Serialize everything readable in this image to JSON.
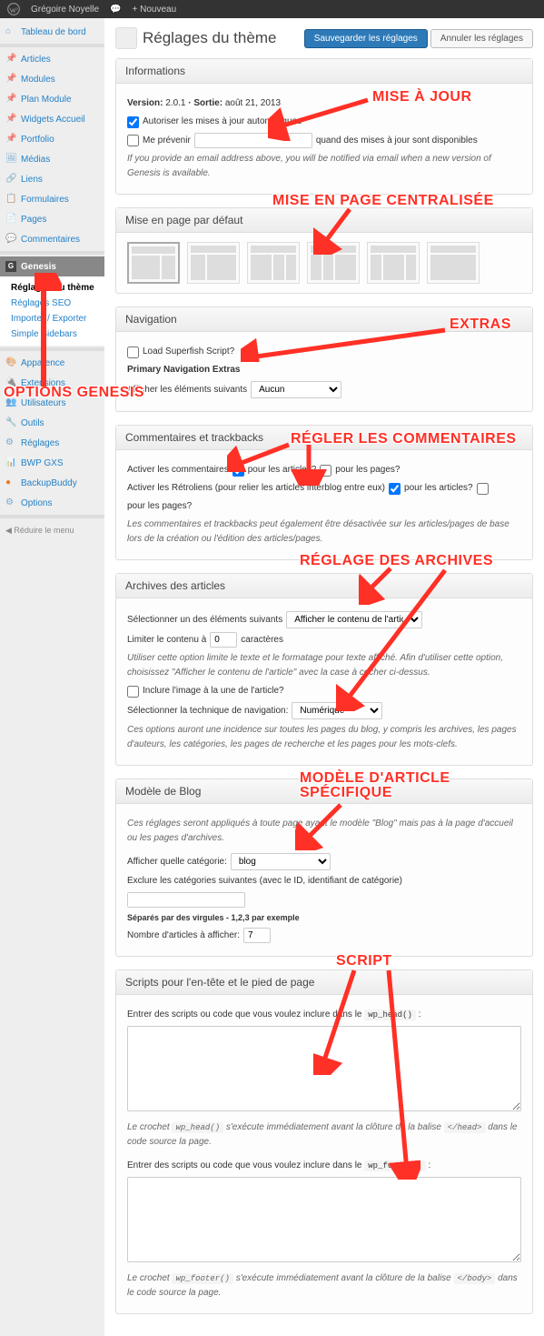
{
  "adminBar": {
    "site": "Grégoire Noyelle",
    "comment": "",
    "new": "+ Nouveau"
  },
  "sidebar": {
    "items": [
      "Tableau de bord",
      "Articles",
      "Modules",
      "Plan Module",
      "Widgets Accueil",
      "Portfolio",
      "Médias",
      "Liens",
      "Formulaires",
      "Pages",
      "Commentaires"
    ],
    "genesis": "Genesis",
    "sub": {
      "theme": "Réglages du thème",
      "seo": "Réglages SEO",
      "import": "Importer / Exporter",
      "sidebars": "Simple Sidebars"
    },
    "lower": [
      "Apparence",
      "Extensions",
      "Utilisateurs",
      "Outils",
      "Réglages",
      "BWP GXS",
      "BackupBuddy",
      "Options"
    ],
    "collapse": "Réduire le menu"
  },
  "header": {
    "title": "Réglages du thème",
    "save": "Sauvegarder les réglages",
    "cancel": "Annuler les réglages"
  },
  "info": {
    "title": "Informations",
    "versionLabel": "Version:",
    "version": "2.0.1",
    "releasedLabel": "· Sortie:",
    "released": "août 21, 2013",
    "autoUpdate": "Autoriser les mises à jour automatiques",
    "notify": "Me prévenir",
    "notifySuffix": "quand des mises à jour sont disponibles",
    "help": "If you provide an email address above, you will be notified via email when a new version of Genesis is available."
  },
  "layout": {
    "title": "Mise en page par défaut"
  },
  "nav": {
    "title": "Navigation",
    "load": "Load Superfish Script?",
    "extras": "Primary Navigation Extras",
    "showLabel": "Afficher les éléments suivants",
    "showValue": "Aucun"
  },
  "comments": {
    "title": "Commentaires et trackbacks",
    "enable": "Activer les commentaires",
    "posts": "pour les articles?",
    "pages": "pour les pages?",
    "trackbacks": "Activer les Rétroliens (pour relier les articles interblog entre eux)",
    "help": "Les commentaires et trackbacks peut également être désactivée sur les articles/pages de base lors de la création ou l'édition des articles/pages."
  },
  "archives": {
    "title": "Archives des articles",
    "selectLabel": "Sélectionner un des éléments suivants",
    "selectValue": "Afficher le contenu de l'article",
    "limitPrefix": "Limiter le contenu à",
    "limitValue": "0",
    "limitSuffix": "caractères",
    "help1": "Utiliser cette option limite le texte et le formatage pour texte affiché. Afin d'utiliser cette option, choisissez \"Afficher le contenu de l'article\" avec la case à cocher ci-dessus.",
    "includeImg": "Inclure l'image à la une de l'article?",
    "navLabel": "Sélectionner la technique de navigation:",
    "navValue": "Numérique",
    "help2": "Ces options auront une incidence sur toutes les pages du blog, y compris les archives, les pages d'auteurs, les catégories, les pages de recherche et les pages pour les mots-clefs."
  },
  "blog": {
    "title": "Modèle de Blog",
    "help1": "Ces réglages seront appliqués à toute page ayant le modèle \"Blog\" mais pas à la page d'accueil ou les pages d'archives.",
    "catLabel": "Afficher quelle catégorie:",
    "catValue": "blog",
    "excludeLabel": "Exclure les catégories suivantes (avec le ID, identifiant de catégorie)",
    "sep": "Séparés par des virgules - 1,2,3 par exemple",
    "countLabel": "Nombre d'articles à afficher:",
    "countValue": "7"
  },
  "scripts": {
    "title": "Scripts pour l'en-tête et le pied de page",
    "headLabel": "Entrer des scripts ou code que vous voulez inclure dans le",
    "headCode": "wp_head()",
    "headHelp1": "Le crochet",
    "headHelp2": "s'exécute immédiatement avant la clôture de la balise",
    "headTag": "</head>",
    "headHelp3": "dans le code source la page.",
    "footLabel": "Entrer des scripts ou code que vous voulez inclure dans le",
    "footCode": "wp_footer()",
    "footTag": "</body>"
  },
  "annotations": {
    "a1": "MISE À JOUR",
    "a2": "MISE EN PAGE CENTRALISÉE",
    "a3": "EXTRAS",
    "a4": "OPTIONS GENESIS",
    "a5": "RÉGLER LES COMMENTAIRES",
    "a6": "RÉGLAGE DES ARCHIVES",
    "a7": "MODÈLE D'ARTICLE SPÉCIFIQUE",
    "a8": "SCRIPT"
  }
}
